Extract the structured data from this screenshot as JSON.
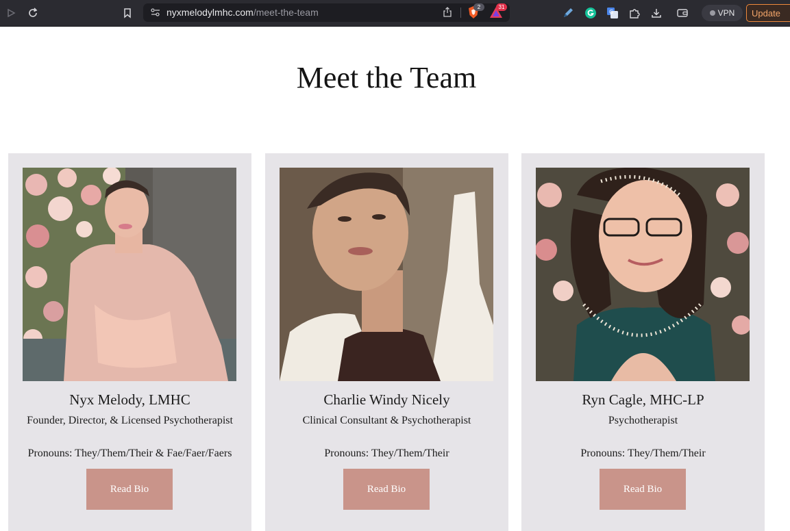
{
  "browser": {
    "url_domain": "nyxmelodylmhc.com",
    "url_path": "/meet-the-team",
    "brave_shield_count": "2",
    "brave_rewards_count": "31",
    "vpn_label": "VPN",
    "update_label": "Update",
    "icons": [
      "play-icon",
      "reload-icon",
      "bookmark-icon",
      "site-settings-icon",
      "share-icon",
      "brave-shield-icon",
      "brave-rewards-icon",
      "pen-icon",
      "grammarly-icon",
      "translate-icon",
      "extensions-icon",
      "download-icon",
      "wallet-icon"
    ]
  },
  "page": {
    "title": "Meet the Team"
  },
  "team": [
    {
      "name": "Nyx Melody, LMHC",
      "role": "Founder, Director, & Licensed Psychotherapist",
      "pronouns": "Pronouns: They/Them/Their & Fae/Faer/Faers",
      "button": "Read Bio"
    },
    {
      "name": "Charlie Windy Nicely",
      "role": "Clinical Consultant & Psychotherapist",
      "pronouns": "Pronouns: They/Them/Their",
      "button": "Read Bio"
    },
    {
      "name": "Ryn Cagle, MHC-LP",
      "role": "Psychotherapist",
      "pronouns": "Pronouns: They/Them/Their",
      "button": "Read Bio"
    }
  ],
  "colors": {
    "card_bg": "#e6e4e8",
    "button_bg": "#c9948a",
    "toolbar_bg": "#2b2b31"
  }
}
